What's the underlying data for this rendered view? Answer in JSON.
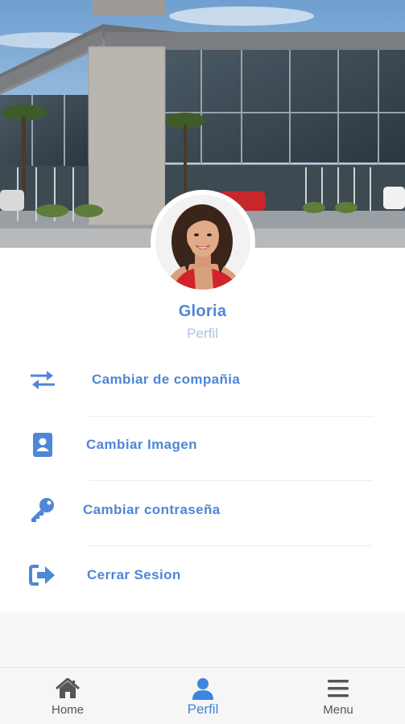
{
  "profile": {
    "name": "Gloria",
    "role": "Perfil"
  },
  "menu": {
    "items": [
      {
        "label": "Cambiar de compañia",
        "icon": "swap-arrows-icon"
      },
      {
        "label": "Cambiar Imagen",
        "icon": "contact-card-icon"
      },
      {
        "label": "Cambiar contraseña",
        "icon": "key-icon"
      },
      {
        "label": "Cerrar Sesion",
        "icon": "sign-out-icon"
      }
    ]
  },
  "bottom_nav": {
    "items": [
      {
        "label": "Home",
        "icon": "home-icon"
      },
      {
        "label": "Perfil",
        "icon": "user-icon",
        "active": true
      },
      {
        "label": "Menu",
        "icon": "hamburger-menu-icon"
      }
    ]
  },
  "colors": {
    "accent": "#4f86d6",
    "active_nav": "#3d86dd",
    "role_text": "#a9c3ea",
    "card_bg": "#ffffff",
    "page_bg": "#f7f7f7"
  }
}
